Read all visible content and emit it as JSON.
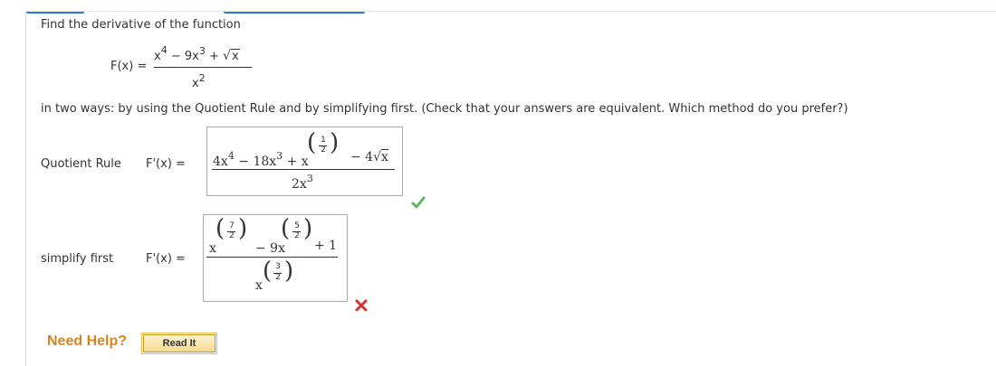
{
  "question": {
    "prompt": "Find the derivative of the function",
    "function": {
      "lhs": "F(x) =",
      "num_x": "x",
      "num_exp4": "4",
      "num_minus9": "− 9x",
      "num_exp3": "3",
      "num_plus": "+",
      "num_sqrt": "x",
      "den_x": "x",
      "den_exp": "2"
    },
    "instructions": "in two ways: by using the Quotient Rule and by simplifying first. (Check that your answers are equivalent. Which method do you prefer?)"
  },
  "quotient_rule": {
    "label": "Quotient Rule",
    "lhs": "F'(x)  =",
    "numerator_a": "4x",
    "exp_a": "4",
    "numerator_b": "− 18x",
    "exp_b": "3",
    "numerator_c": "+ x",
    "exp_c_num": "1",
    "exp_c_den": "2",
    "numerator_d": "− 4",
    "sqrt_arg": "x",
    "denominator": "2x",
    "den_exp": "3",
    "status": "correct",
    "status_color": "#5cb85c"
  },
  "simplify_first": {
    "label": "simplify first",
    "lhs": "F'(x)  =",
    "term1_base": "x",
    "term1_exp_num": "7",
    "term1_exp_den": "2",
    "term2": "− 9x",
    "term2_exp_num": "5",
    "term2_exp_den": "2",
    "term3": "+ 1",
    "den_base": "x",
    "den_exp_num": "3",
    "den_exp_den": "2",
    "status": "incorrect",
    "status_color": "#d9302b"
  },
  "help": {
    "label": "Need Help?",
    "read_it": "Read It"
  }
}
